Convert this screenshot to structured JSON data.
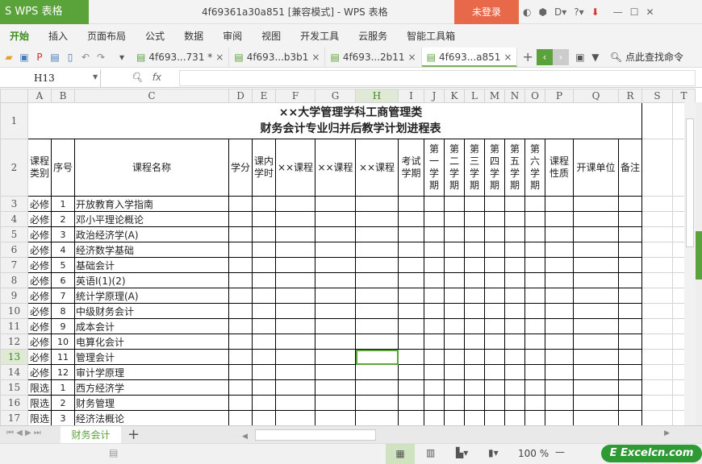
{
  "app": {
    "logo": "S WPS 表格",
    "title": "4f69361a30a851 [兼容模式] - WPS 表格",
    "login": "未登录"
  },
  "menu": [
    "开始",
    "插入",
    "页面布局",
    "公式",
    "数据",
    "审阅",
    "视图",
    "开发工具",
    "云服务",
    "智能工具箱"
  ],
  "doc_tabs": [
    "4f693...731 *",
    "4f693...b3b1",
    "4f693...2b11",
    "4f693...a851"
  ],
  "search_label": "点此查找命令",
  "namebox": "H13",
  "fx": "fx",
  "columns": [
    "A",
    "B",
    "C",
    "D",
    "E",
    "F",
    "G",
    "H",
    "I",
    "J",
    "K",
    "L",
    "M",
    "N",
    "O",
    "P",
    "Q",
    "R",
    "S",
    "T"
  ],
  "title1": "××大学管理学科工商管理类",
  "title2": "财务会计专业归并后教学计划进程表",
  "headers": [
    "课程类别",
    "序号",
    "课程名称",
    "学分",
    "课内学时",
    "××课程",
    "××课程",
    "××课程",
    "考试学期",
    "第一学期",
    "第二学期",
    "第三学期",
    "第四学期",
    "第五学期",
    "第六学期",
    "课程性质",
    "开课单位",
    "备注"
  ],
  "rows": [
    [
      "必修",
      "1",
      "开放教育入学指南"
    ],
    [
      "必修",
      "2",
      "邓小平理论概论"
    ],
    [
      "必修",
      "3",
      "政治经济学(A)"
    ],
    [
      "必修",
      "4",
      "经济数学基础"
    ],
    [
      "必修",
      "5",
      "基础会计"
    ],
    [
      "必修",
      "6",
      "英语Ⅰ(1)(2)"
    ],
    [
      "必修",
      "7",
      "统计学原理(A)"
    ],
    [
      "必修",
      "8",
      "中级财务会计"
    ],
    [
      "必修",
      "9",
      "成本会计"
    ],
    [
      "必修",
      "10",
      "电算化会计"
    ],
    [
      "必修",
      "11",
      "管理会计"
    ],
    [
      "必修",
      "12",
      "审计学原理"
    ],
    [
      "限选",
      "1",
      "西方经济学"
    ],
    [
      "限选",
      "2",
      "财务管理"
    ],
    [
      "限选",
      "3",
      "经济法概论"
    ]
  ],
  "sheet_tab": "财务会计",
  "zoom": "100 %",
  "watermark": "Excelcn.com"
}
